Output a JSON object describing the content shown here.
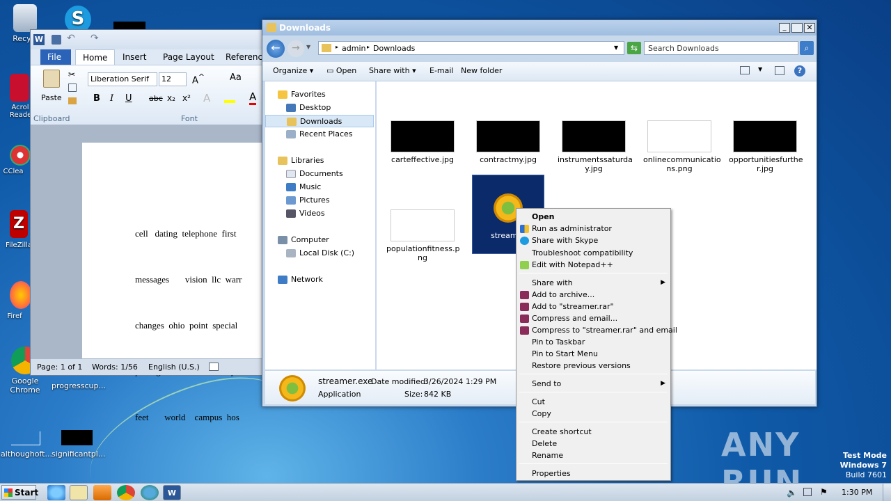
{
  "desktop": {
    "icons": [
      {
        "label": "Recycl"
      },
      {
        "label": "Acrol Reade"
      },
      {
        "label": "CClea"
      },
      {
        "label": "FileZilla"
      },
      {
        "label": "Firef"
      },
      {
        "label": "Google Chrome"
      },
      {
        "label": "progresscup..."
      },
      {
        "label": "althoughoft..."
      },
      {
        "label": "significantpl..."
      }
    ],
    "watermark": "ANY RUN",
    "test_mode": "Test Mode",
    "windows": "Windows 7",
    "build": "Build 7601"
  },
  "word": {
    "tabs": [
      "File",
      "Home",
      "Insert",
      "Page Layout",
      "Reference:"
    ],
    "font_name": "Liberation Serif",
    "font_size": "12",
    "paste_label": "Paste",
    "clipboard_label": "Clipboard",
    "font_group_label": "Font",
    "doc_lines": [
      "cell   dating  telephone  first",
      "messages       vision  llc  warr",
      "changes  ohio  point  special",
      "packages  safe    rated    say  c",
      "feet       world    campus  hos"
    ],
    "status_page": "Page: 1 of 1",
    "status_words": "Words: 1/56",
    "status_lang": "English (U.S.)"
  },
  "explorer": {
    "title": "Downloads",
    "breadcrumb": [
      "admin",
      "Downloads"
    ],
    "search_placeholder": "Search Downloads",
    "toolbar": [
      "Organize",
      "Open",
      "Share with",
      "E-mail",
      "New folder"
    ],
    "nav": {
      "favorites": "Favorites",
      "desktop": "Desktop",
      "downloads": "Downloads",
      "recent": "Recent Places",
      "libraries": "Libraries",
      "documents": "Documents",
      "music": "Music",
      "pictures": "Pictures",
      "videos": "Videos",
      "computer": "Computer",
      "local_disk": "Local Disk (C:)",
      "network": "Network"
    },
    "files": [
      {
        "name": "carteffective.jpg"
      },
      {
        "name": "contractmy.jpg"
      },
      {
        "name": "instrumentssaturda y.jpg"
      },
      {
        "name": "onlinecommunicatio ns.png"
      },
      {
        "name": "opportunitiesfurthe r.jpg"
      },
      {
        "name": "populationfitness.p ng"
      },
      {
        "name": "streamer"
      }
    ],
    "details": {
      "name": "streamer.exe",
      "modified_label": "Date modified:",
      "modified": "3/26/2024 1:29 PM",
      "type": "Application",
      "size_label": "Size:",
      "size": "842 KB"
    }
  },
  "context_menu": {
    "items": [
      "Open",
      "Run as administrator",
      "Share with Skype",
      "Troubleshoot compatibility",
      "Edit with Notepad++",
      "Share with",
      "Add to archive...",
      "Add to \"streamer.rar\"",
      "Compress and email...",
      "Compress to \"streamer.rar\" and email",
      "Pin to Taskbar",
      "Pin to Start Menu",
      "Restore previous versions",
      "Send to",
      "Cut",
      "Copy",
      "Create shortcut",
      "Delete",
      "Rename",
      "Properties"
    ]
  },
  "taskbar": {
    "start": "Start",
    "time": "1:30 PM"
  }
}
